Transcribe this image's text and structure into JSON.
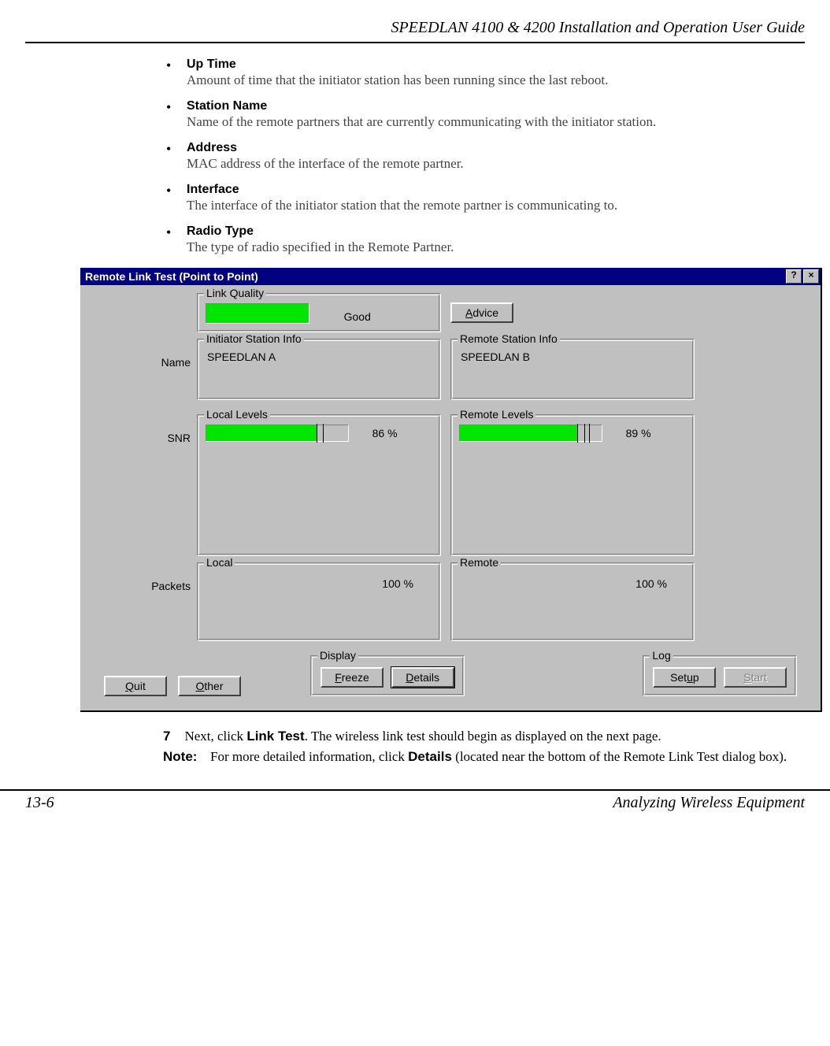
{
  "header": {
    "title": "SPEEDLAN 4100 & 4200 Installation and Operation User Guide"
  },
  "bullets": [
    {
      "term": "Up Time",
      "desc": "Amount of time that the initiator station has been running since the last reboot."
    },
    {
      "term": "Station Name",
      "desc": "Name of the remote partners that are currently communicating with the initiator station."
    },
    {
      "term": "Address",
      "desc": "MAC address of the interface of the remote partner."
    },
    {
      "term": "Interface",
      "desc": "The interface of the initiator station that the remote partner is communicating to."
    },
    {
      "term": "Radio Type",
      "desc": "The type of radio specified in the Remote Partner."
    }
  ],
  "dialog": {
    "title": "Remote Link Test (Point to Point)",
    "help_icon": "?",
    "close_icon": "×",
    "link_quality": {
      "legend": "Link Quality",
      "rating": "Good",
      "advice_btn": "Advice",
      "advice_accel": "A"
    },
    "row_name_label": "Name",
    "initiator": {
      "legend": "Initiator Station Info",
      "value": "SPEEDLAN A"
    },
    "remote": {
      "legend": "Remote Station Info",
      "value": "SPEEDLAN B"
    },
    "row_snr_label": "SNR",
    "local_levels": {
      "legend": "Local Levels",
      "pct": "86 %",
      "fill": 78
    },
    "remote_levels": {
      "legend": "Remote Levels",
      "pct": "89 %",
      "fill": 83
    },
    "row_packets_label": "Packets",
    "local_packets": {
      "legend": "Local",
      "pct": "100 %"
    },
    "remote_packets": {
      "legend": "Remote",
      "pct": "100 %"
    },
    "buttons": {
      "quit": "Quit",
      "quit_accel": "Q",
      "other": "Other",
      "other_accel": "O",
      "display_legend": "Display",
      "freeze": "Freeze",
      "freeze_accel": "F",
      "details": "Details",
      "details_accel": "D",
      "log_legend": "Log",
      "setup": "Setup",
      "setup_accel": "S",
      "start": "Start",
      "start_accel": "S"
    }
  },
  "step": {
    "num": "7",
    "pre": "Next, click ",
    "bold": "Link Test",
    "post": ".  The wireless link test should begin as displayed on the next page."
  },
  "note": {
    "label": "Note:",
    "pre": "For more detailed information, click ",
    "bold": "Details",
    "post": " (located near the bottom of the Remote Link Test dialog box)."
  },
  "footer": {
    "page": "13-6",
    "section": "Analyzing Wireless Equipment"
  }
}
